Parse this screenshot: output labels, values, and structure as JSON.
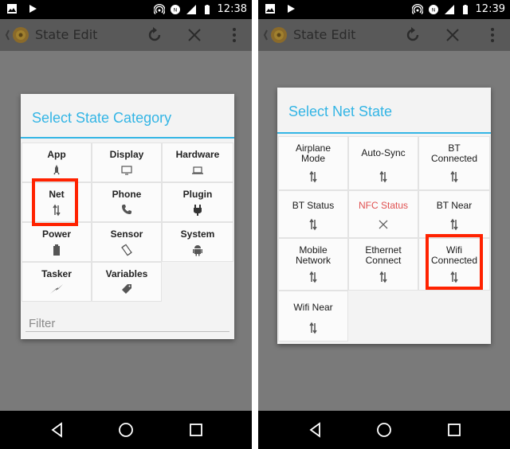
{
  "screens": [
    {
      "status": {
        "time": "12:38"
      },
      "actionbar": {
        "title": "State Edit"
      },
      "dialog": {
        "title": "Select State Category",
        "filter_placeholder": "Filter",
        "tiles": [
          {
            "label": "App",
            "icon": "app-icon"
          },
          {
            "label": "Display",
            "icon": "display-icon"
          },
          {
            "label": "Hardware",
            "icon": "hardware-icon"
          },
          {
            "label": "Net",
            "icon": "net-arrows-icon"
          },
          {
            "label": "Phone",
            "icon": "phone-icon"
          },
          {
            "label": "Plugin",
            "icon": "plugin-icon"
          },
          {
            "label": "Power",
            "icon": "battery-icon"
          },
          {
            "label": "Sensor",
            "icon": "sensor-icon"
          },
          {
            "label": "System",
            "icon": "android-icon"
          },
          {
            "label": "Tasker",
            "icon": "lightning-icon"
          },
          {
            "label": "Variables",
            "icon": "tag-icon"
          }
        ]
      }
    },
    {
      "status": {
        "time": "12:39"
      },
      "actionbar": {
        "title": "State Edit"
      },
      "dialog": {
        "title": "Select Net State",
        "tiles": [
          {
            "label": "Airplane\nMode",
            "icon": "net-arrows-icon"
          },
          {
            "label": "Auto-Sync",
            "icon": "net-arrows-icon"
          },
          {
            "label": "BT\nConnected",
            "icon": "net-arrows-icon"
          },
          {
            "label": "BT Status",
            "icon": "net-arrows-icon"
          },
          {
            "label": "NFC Status",
            "icon": "close-x-icon",
            "color": "#e05050"
          },
          {
            "label": "BT Near",
            "icon": "net-arrows-icon"
          },
          {
            "label": "Mobile\nNetwork",
            "icon": "net-arrows-icon"
          },
          {
            "label": "Ethernet\nConnect",
            "icon": "net-arrows-icon"
          },
          {
            "label": "Wifi\nConnected",
            "icon": "net-arrows-icon"
          },
          {
            "label": "Wifi Near",
            "icon": "net-arrows-icon"
          }
        ]
      }
    }
  ]
}
